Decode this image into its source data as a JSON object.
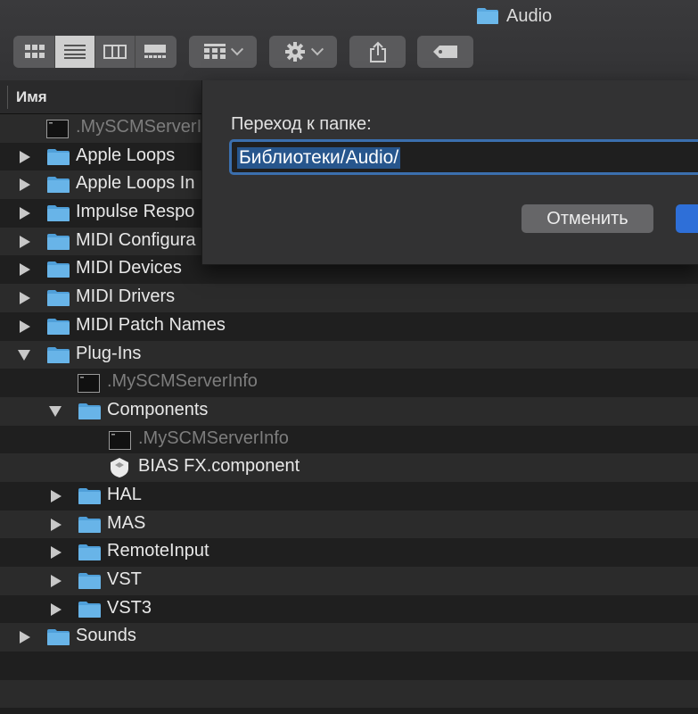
{
  "window": {
    "title": "Audio",
    "title_icon": "folder-icon"
  },
  "toolbar": {
    "views": [
      "icon-view",
      "list-view",
      "column-view",
      "gallery-view"
    ],
    "active_view": "list-view",
    "group_button": "group-by-icon",
    "action_button": "gear-icon",
    "share_button": "share-icon",
    "tag_button": "tag-icon"
  },
  "header": {
    "name_column": "Имя"
  },
  "files": [
    {
      "name": ".MySCMServerInfo",
      "type": "doc",
      "level": 0,
      "expand": "none",
      "dim": true
    },
    {
      "name": "Apple Loops",
      "type": "folder",
      "level": 0,
      "expand": "closed",
      "dim": false
    },
    {
      "name": "Apple Loops In",
      "type": "folder",
      "level": 0,
      "expand": "closed",
      "dim": false
    },
    {
      "name": "Impulse Respo",
      "type": "folder",
      "level": 0,
      "expand": "closed",
      "dim": false
    },
    {
      "name": "MIDI Configura",
      "type": "folder",
      "level": 0,
      "expand": "closed",
      "dim": false
    },
    {
      "name": "MIDI Devices",
      "type": "folder",
      "level": 0,
      "expand": "closed",
      "dim": false
    },
    {
      "name": "MIDI Drivers",
      "type": "folder",
      "level": 0,
      "expand": "closed",
      "dim": false
    },
    {
      "name": "MIDI Patch Names",
      "type": "folder",
      "level": 0,
      "expand": "closed",
      "dim": false
    },
    {
      "name": "Plug-Ins",
      "type": "folder",
      "level": 0,
      "expand": "open",
      "dim": false
    },
    {
      "name": ".MySCMServerInfo",
      "type": "doc",
      "level": 1,
      "expand": "none",
      "dim": true
    },
    {
      "name": "Components",
      "type": "folder",
      "level": 1,
      "expand": "open",
      "dim": false
    },
    {
      "name": ".MySCMServerInfo",
      "type": "doc",
      "level": 2,
      "expand": "none",
      "dim": true
    },
    {
      "name": "BIAS FX.component",
      "type": "component",
      "level": 2,
      "expand": "none",
      "dim": false
    },
    {
      "name": "HAL",
      "type": "folder",
      "level": 1,
      "expand": "closed",
      "dim": false
    },
    {
      "name": "MAS",
      "type": "folder",
      "level": 1,
      "expand": "closed",
      "dim": false
    },
    {
      "name": "RemoteInput",
      "type": "folder",
      "level": 1,
      "expand": "closed",
      "dim": false
    },
    {
      "name": "VST",
      "type": "folder",
      "level": 1,
      "expand": "closed",
      "dim": false
    },
    {
      "name": "VST3",
      "type": "folder",
      "level": 1,
      "expand": "closed",
      "dim": false
    },
    {
      "name": "Sounds",
      "type": "folder",
      "level": 0,
      "expand": "closed",
      "dim": false
    },
    {
      "name": "",
      "type": "empty",
      "level": 0,
      "expand": "none",
      "dim": false
    },
    {
      "name": "",
      "type": "empty",
      "level": 0,
      "expand": "none",
      "dim": false
    }
  ],
  "dialog": {
    "label": "Переход к папке:",
    "path_value": "Библиотеки/Audio/",
    "cancel_label": "Отменить",
    "go_label": ""
  }
}
